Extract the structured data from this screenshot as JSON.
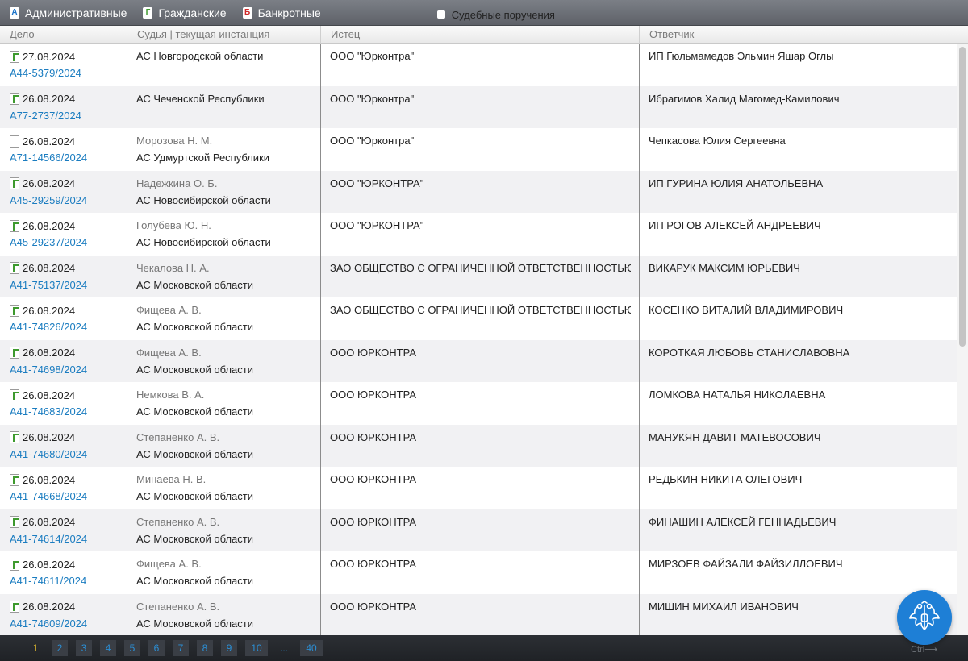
{
  "filters": {
    "admin": {
      "badge": "А",
      "label": "Административные"
    },
    "civil": {
      "badge": "Г",
      "label": "Гражданские"
    },
    "bankrupt": {
      "badge": "Б",
      "label": "Банкротные"
    },
    "court_orders": {
      "label": "Судебные поручения"
    }
  },
  "columns": {
    "case": "Дело",
    "judge": "Судья | текущая инстанция",
    "plaintiff": "Истец",
    "defendant": "Ответчик"
  },
  "rows": [
    {
      "doc": "g",
      "date": "27.08.2024",
      "case": "А44-5379/2024",
      "judge": "",
      "court": "АС Новгородской области",
      "plaintiff": "ООО \"Юрконтра\"",
      "defendant": "ИП Гюльмамедов Эльмин Яшар Оглы"
    },
    {
      "doc": "g",
      "date": "26.08.2024",
      "case": "А77-2737/2024",
      "judge": "",
      "court": "АС Чеченской Республики",
      "plaintiff": "ООО \"Юрконтра\"",
      "defendant": "Ибрагимов Халид Магомед-Камилович"
    },
    {
      "doc": "blank",
      "date": "26.08.2024",
      "case": "А71-14566/2024",
      "judge": "Морозова Н. М.",
      "court": "АС Удмуртской Республики",
      "plaintiff": "ООО \"Юрконтра\"",
      "defendant": "Чепкасова Юлия Сергеевна"
    },
    {
      "doc": "g",
      "date": "26.08.2024",
      "case": "А45-29259/2024",
      "judge": "Надежкина О. Б.",
      "court": "АС Новосибирской области",
      "plaintiff": "ООО \"ЮРКОНТРА\"",
      "defendant": "ИП ГУРИНА ЮЛИЯ АНАТОЛЬЕВНА"
    },
    {
      "doc": "g",
      "date": "26.08.2024",
      "case": "А45-29237/2024",
      "judge": "Голубева Ю. Н.",
      "court": "АС Новосибирской области",
      "plaintiff": "ООО \"ЮРКОНТРА\"",
      "defendant": "ИП РОГОВ АЛЕКСЕЙ АНДРЕЕВИЧ"
    },
    {
      "doc": "g",
      "date": "26.08.2024",
      "case": "А41-75137/2024",
      "judge": "Чекалова Н. А.",
      "court": "АС Московской области",
      "plaintiff": "ЗАО ОБЩЕСТВО С ОГРАНИЧЕННОЙ ОТВЕТСТВЕННОСТЬЮ \"ЮРКОНТРА\"",
      "defendant": "ВИКАРУК МАКСИМ ЮРЬЕВИЧ"
    },
    {
      "doc": "g",
      "date": "26.08.2024",
      "case": "А41-74826/2024",
      "judge": "Фищева А. В.",
      "court": "АС Московской области",
      "plaintiff": "ЗАО ОБЩЕСТВО С ОГРАНИЧЕННОЙ ОТВЕТСТВЕННОСТЬЮ \"ЮРКОНТРА\"",
      "defendant": "КОСЕНКО ВИТАЛИЙ ВЛАДИМИРОВИЧ"
    },
    {
      "doc": "g",
      "date": "26.08.2024",
      "case": "А41-74698/2024",
      "judge": "Фищева А. В.",
      "court": "АС Московской области",
      "plaintiff": "ООО ЮРКОНТРА",
      "defendant": "КОРОТКАЯ ЛЮБОВЬ СТАНИСЛАВОВНА"
    },
    {
      "doc": "g",
      "date": "26.08.2024",
      "case": "А41-74683/2024",
      "judge": "Немкова В. А.",
      "court": "АС Московской области",
      "plaintiff": "ООО ЮРКОНТРА",
      "defendant": "ЛОМКОВА НАТАЛЬЯ НИКОЛАЕВНА"
    },
    {
      "doc": "g",
      "date": "26.08.2024",
      "case": "А41-74680/2024",
      "judge": "Степаненко А. В.",
      "court": "АС Московской области",
      "plaintiff": "ООО ЮРКОНТРА",
      "defendant": "МАНУКЯН ДАВИТ МАТЕВОСОВИЧ"
    },
    {
      "doc": "g",
      "date": "26.08.2024",
      "case": "А41-74668/2024",
      "judge": "Минаева Н. В.",
      "court": "АС Московской области",
      "plaintiff": "ООО ЮРКОНТРА",
      "defendant": "РЕДЬКИН НИКИТА ОЛЕГОВИЧ"
    },
    {
      "doc": "g",
      "date": "26.08.2024",
      "case": "А41-74614/2024",
      "judge": "Степаненко А. В.",
      "court": "АС Московской области",
      "plaintiff": "ООО ЮРКОНТРА",
      "defendant": "ФИНАШИН АЛЕКСЕЙ ГЕННАДЬЕВИЧ"
    },
    {
      "doc": "g",
      "date": "26.08.2024",
      "case": "А41-74611/2024",
      "judge": "Фищева А. В.",
      "court": "АС Московской области",
      "plaintiff": "ООО ЮРКОНТРА",
      "defendant": "МИРЗОЕВ ФАЙЗАЛИ ФАЙЗИЛЛОЕВИЧ"
    },
    {
      "doc": "g",
      "date": "26.08.2024",
      "case": "А41-74609/2024",
      "judge": "Степаненко А. В.",
      "court": "АС Московской области",
      "plaintiff": "ООО ЮРКОНТРА",
      "defendant": "МИШИН МИХАИЛ ИВАНОВИЧ"
    }
  ],
  "pager": {
    "pages": [
      "1",
      "2",
      "3",
      "4",
      "5",
      "6",
      "7",
      "8",
      "9",
      "10",
      "...",
      "40"
    ],
    "current": "1",
    "hint": "Ctrl⟶"
  },
  "colors": {
    "link": "#1a7cc0",
    "current_page": "#f0c62d",
    "emblem": "#1e7fd6"
  },
  "icons": {
    "emblem": "double-headed-eagle-icon"
  }
}
